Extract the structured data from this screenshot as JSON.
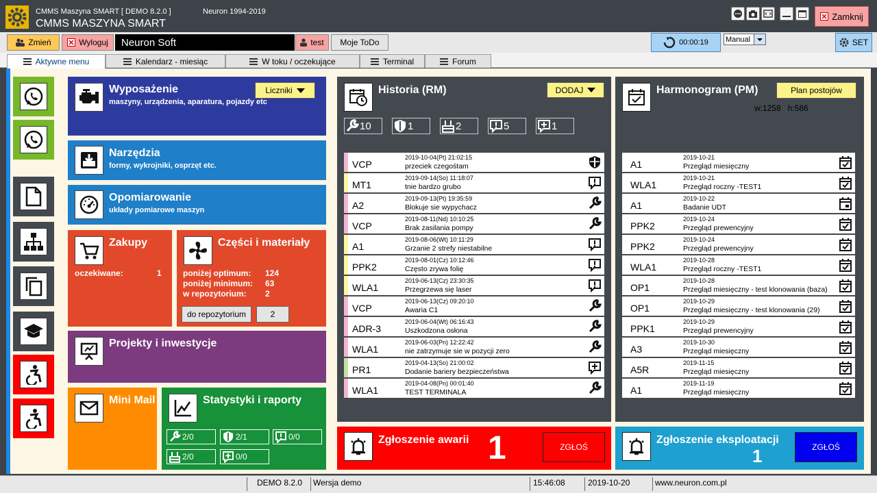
{
  "app": {
    "title_small": "CMMS Maszyna SMART  [ DEMO 8.2.0 ]",
    "title_big": "CMMS MASZYNA SMART",
    "company_note": "Neuron 1994-2019",
    "close_label": "Zamknij"
  },
  "toolbar": {
    "change_label": "Zmień",
    "logout_label": "Wyloguj",
    "company_name": "Neuron Soft",
    "user_name": "test",
    "todo_label": "Moje ToDo",
    "timer": "00:00:19",
    "mode_select": "Manual",
    "set_label": "SET"
  },
  "tabs": [
    "Aktywne menu",
    "Kalendarz - miesiąc",
    "W toku / oczekujące",
    "Terminal",
    "Forum"
  ],
  "tiles": {
    "wyposazenie": {
      "title": "Wyposażenie",
      "subtitle": "maszyny, urządzenia, aparatura, pojazdy etc",
      "button": "Liczniki"
    },
    "narzedzia": {
      "title": "Narzędzia",
      "subtitle": "formy, wykrojniki, osprzęt etc."
    },
    "opomiarowanie": {
      "title": "Opomiarowanie",
      "subtitle": "układy pomiarowe maszyn"
    },
    "zakupy": {
      "title": "Zakupy",
      "label": "oczekiwane:",
      "value": "1"
    },
    "czesci": {
      "title": "Części i materiały",
      "rows": [
        {
          "label": "poniżej optimum:",
          "value": "124"
        },
        {
          "label": "poniżej minimum:",
          "value": "63"
        },
        {
          "label": "w repozytorium:",
          "value": "2"
        }
      ],
      "repo_button": "do repozytorium",
      "repo_count": "2"
    },
    "projekty": {
      "title": "Projekty i inwestycje"
    },
    "minimail": {
      "title": "Mini Mail"
    },
    "statystyki": {
      "title": "Statystyki i raporty",
      "counters": [
        {
          "icon": "wrench-icon",
          "value": "2/0"
        },
        {
          "icon": "shield-icon",
          "value": "2/1"
        },
        {
          "icon": "alert-comment-icon",
          "value": "0/0"
        },
        {
          "icon": "tools-box-icon",
          "value": "2/0"
        },
        {
          "icon": "plus-comment-icon",
          "value": "0/0"
        }
      ]
    }
  },
  "historia": {
    "title": "Historia (RM)",
    "add_button": "DODAJ",
    "counters": [
      {
        "icon": "wrench-icon",
        "value": "10"
      },
      {
        "icon": "shield-icon",
        "value": "1"
      },
      {
        "icon": "tools-box-icon",
        "value": "2"
      },
      {
        "icon": "alert-comment-icon",
        "value": "5"
      },
      {
        "icon": "plus-comment-icon",
        "value": "1"
      }
    ],
    "rows": [
      {
        "code": "VCP",
        "date": "2019-10-04(Pt) 21:02:15",
        "desc": "przeciek czegośtam",
        "icon": "shield",
        "bar": "#f4b6cf"
      },
      {
        "code": "MT1",
        "date": "2019-09-14(So) 11:18:07",
        "desc": "tnie bardzo grubo",
        "icon": "alert",
        "bar": "#fff59d"
      },
      {
        "code": "A2",
        "date": "2019-09-13(Pt) 19:35:59",
        "desc": "Blokuje sie wypychacz",
        "icon": "wrench",
        "bar": "#f4b6cf"
      },
      {
        "code": "VCP",
        "date": "2019-08-11(Nd) 10:10:25",
        "desc": "Brak zasilania pompy",
        "icon": "wrench",
        "bar": "#f4b6cf"
      },
      {
        "code": "A1",
        "date": "2019-08-06(Wt) 10:11:29",
        "desc": "Grzanie 2 strefy niestabilne",
        "icon": "alert",
        "bar": "#fff59d"
      },
      {
        "code": "PPK2",
        "date": "2019-08-01(Cz) 10:12:46",
        "desc": "Często zrywa folię",
        "icon": "alert",
        "bar": "#fff59d"
      },
      {
        "code": "WLA1",
        "date": "2019-06-13(Cz) 23:30:35",
        "desc": "Przegrzewa się laser",
        "icon": "alert",
        "bar": "#fff59d"
      },
      {
        "code": "VCP",
        "date": "2019-06-13(Cz) 09:20:10",
        "desc": "Awaria C1",
        "icon": "wrench",
        "bar": "#f4b6cf"
      },
      {
        "code": "ADR-3",
        "date": "2019-06-04(Wt) 06:16:43",
        "desc": "Uszkodzona osłona",
        "icon": "wrench",
        "bar": "#f4b6cf"
      },
      {
        "code": "WLA1",
        "date": "2019-06-03(Pn) 12:22:42",
        "desc": "nie zatrzymuje sie w pozycji zero",
        "icon": "wrench",
        "bar": "#f4b6cf"
      },
      {
        "code": "PR1",
        "date": "2019-04-13(So) 21:00:02",
        "desc": "Dodanie bariery bezpieczeństwa",
        "icon": "plus",
        "bar": "#c5e1a5"
      },
      {
        "code": "WLA1",
        "date": "2019-04-08(Pn) 00:01:40",
        "desc": "TEST TERMINALA",
        "icon": "wrench",
        "bar": "#f4b6cf"
      }
    ]
  },
  "harmonogram": {
    "title": "Harmonogram (PM)",
    "plan_button": "Plan postojów",
    "dims": "w:1258   h:586",
    "rows": [
      {
        "code": "A1",
        "date": "2019-10-21",
        "desc": "Przegląd miesięczny",
        "icon": "check"
      },
      {
        "code": "WLA1",
        "date": "2019-10-21",
        "desc": "Przegląd roczny -TEST1",
        "icon": "check"
      },
      {
        "code": "A1",
        "date": "2019-10-22",
        "desc": "Badanie UDT",
        "icon": "day"
      },
      {
        "code": "PPK2",
        "date": "2019-10-24",
        "desc": "Przegląd prewencyjny",
        "icon": "check"
      },
      {
        "code": "PPK2",
        "date": "2019-10-24",
        "desc": "Przegląd prewencyjny",
        "icon": "check"
      },
      {
        "code": "WLA1",
        "date": "2019-10-28",
        "desc": "Przegląd roczny -TEST1",
        "icon": "check"
      },
      {
        "code": "OP1",
        "date": "2019-10-28",
        "desc": "Przegląd miesięczny - test klonowania (baza)",
        "icon": "check"
      },
      {
        "code": "OP1",
        "date": "2019-10-29",
        "desc": "Przegląd miesięczny - test klonowania (29)",
        "icon": "check"
      },
      {
        "code": "PPK1",
        "date": "2019-10-29",
        "desc": "Przegląd prewencyjny",
        "icon": "check"
      },
      {
        "code": "A3",
        "date": "2019-10-30",
        "desc": "Przegląd miesięczny",
        "icon": "check"
      },
      {
        "code": "A5R",
        "date": "2019-11-15",
        "desc": "Przegląd miesięczny",
        "icon": "check"
      },
      {
        "code": "A1",
        "date": "2019-11-19",
        "desc": "Przegląd miesięczny",
        "icon": "check"
      }
    ]
  },
  "awarie": {
    "title": "Zgłoszenie awarii",
    "count": "1",
    "button": "ZGŁOŚ"
  },
  "eksploatacja": {
    "title": "Zgłoszenie eksploatacji",
    "count": "1",
    "button": "ZGŁOŚ"
  },
  "status": {
    "version": "DEMO 8.2.0",
    "edition": "Wersja demo",
    "time": "15:46:08",
    "date": "2019-10-20",
    "url": "www.neuron.com.pl"
  },
  "colors": {
    "blue": "#2e3b9e",
    "lightblue": "#1f7fc8",
    "orange_red": "#e2492b",
    "purple": "#7b3b7e",
    "orange": "#ff8c00",
    "green": "#17913a",
    "red": "#ff0000",
    "cyan": "#1ea0d0"
  }
}
